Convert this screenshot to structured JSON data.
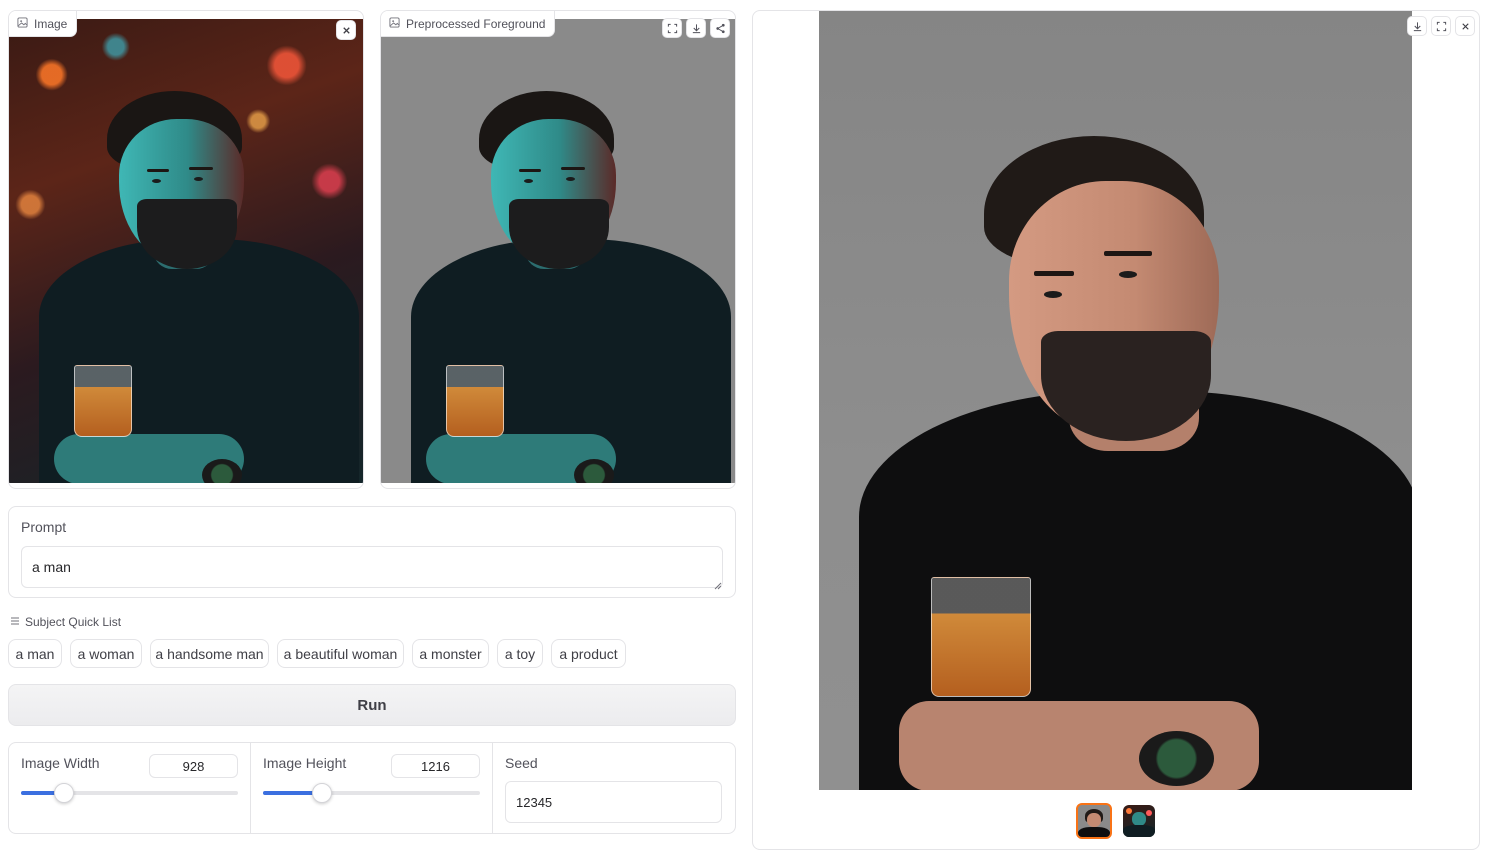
{
  "image_panel": {
    "label": "Image",
    "icon": "image-icon",
    "close_icon": "close-icon"
  },
  "foreground_panel": {
    "label": "Preprocessed Foreground",
    "icon": "image-icon",
    "actions": [
      "fullscreen-icon",
      "download-icon",
      "share-icon"
    ]
  },
  "prompt": {
    "label": "Prompt",
    "value": "a man"
  },
  "quick_list": {
    "label": "Subject Quick List",
    "icon": "list-icon",
    "items": [
      "a man",
      "a woman",
      "a handsome man",
      "a beautiful woman",
      "a monster",
      "a toy",
      "a product"
    ]
  },
  "run_button": {
    "label": "Run"
  },
  "settings": {
    "width": {
      "label": "Image Width",
      "value": "928",
      "fraction": 0.2
    },
    "height": {
      "label": "Image Height",
      "value": "1216",
      "fraction": 0.27
    },
    "seed": {
      "label": "Seed",
      "value": "12345"
    }
  },
  "output_gallery": {
    "actions": [
      "download-icon",
      "fullscreen-icon",
      "close-icon"
    ],
    "thumbnails": [
      "result-grey-background",
      "result-original-background"
    ],
    "selected_index": 0
  },
  "colors": {
    "accent": "#3b6fe0",
    "thumb_selected": "#f97316",
    "border": "#e4e4e7",
    "run_bg": "#f0f0f2"
  }
}
